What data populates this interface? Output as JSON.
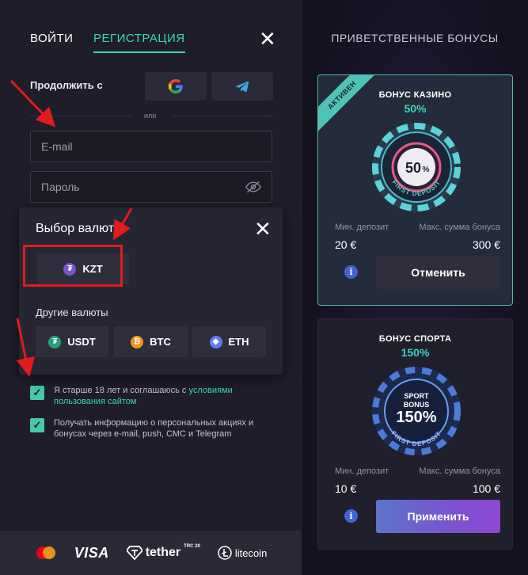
{
  "auth": {
    "tabs": [
      {
        "label": "ВОЙТИ"
      },
      {
        "label": "РЕГИСТРАЦИЯ"
      }
    ],
    "continue_with": "Продолжить с",
    "or_text": "или",
    "email_placeholder": "E-mail",
    "password_placeholder": "Пароль",
    "checkboxes": [
      {
        "text": "Я старше 18 лет и соглашаюсь с ",
        "link": "условиями пользования сайтом",
        "checked": true
      },
      {
        "text": "Получать информацию о персональных акциях и бонусах через e-mail, push, СМС и Telegram",
        "checked": true
      }
    ]
  },
  "currency_modal": {
    "title": "Выбор валюты",
    "selected": {
      "code": "KZT",
      "icon": "tether-icon"
    },
    "other_label": "Другие валюты",
    "others": [
      {
        "code": "USDT",
        "icon": "tether-icon"
      },
      {
        "code": "BTC",
        "icon": "bitcoin-icon"
      },
      {
        "code": "ETH",
        "icon": "ethereum-icon"
      }
    ]
  },
  "footer": {
    "payments": [
      "mastercard-icon",
      "VISA",
      "tether",
      "TRC 20",
      "litecoin"
    ]
  },
  "bonuses": {
    "title": "ПРИВЕТСТВЕННЫЕ БОНУСЫ",
    "cards": [
      {
        "ribbon": "АКТИВЕН",
        "name": "БОНУС КАЗИНО",
        "percent": "50%",
        "chip_value": "50",
        "chip_percent": "%",
        "chip_text": "FIRST DEPOSIT",
        "min_label": "Мин. депозит",
        "max_label": "Макс. сумма бонуса",
        "min_value": "20 €",
        "max_value": "300 €",
        "button": "Отменить"
      },
      {
        "name": "БОНУС СПОРТА",
        "percent": "150%",
        "chip_top": "SPORT",
        "chip_mid": "BONUS",
        "chip_value": "150%",
        "chip_text": "FIRST DEPOSIT",
        "min_label": "Мин. депозит",
        "max_label": "Макс. сумма бонуса",
        "min_value": "10 €",
        "max_value": "100 €",
        "button": "Применить"
      }
    ]
  },
  "colors": {
    "accent": "#3ad6bd",
    "annotation_red": "#e21b1b",
    "apply_gradient_start": "#5c75c9",
    "apply_gradient_end": "#8e47d4"
  }
}
